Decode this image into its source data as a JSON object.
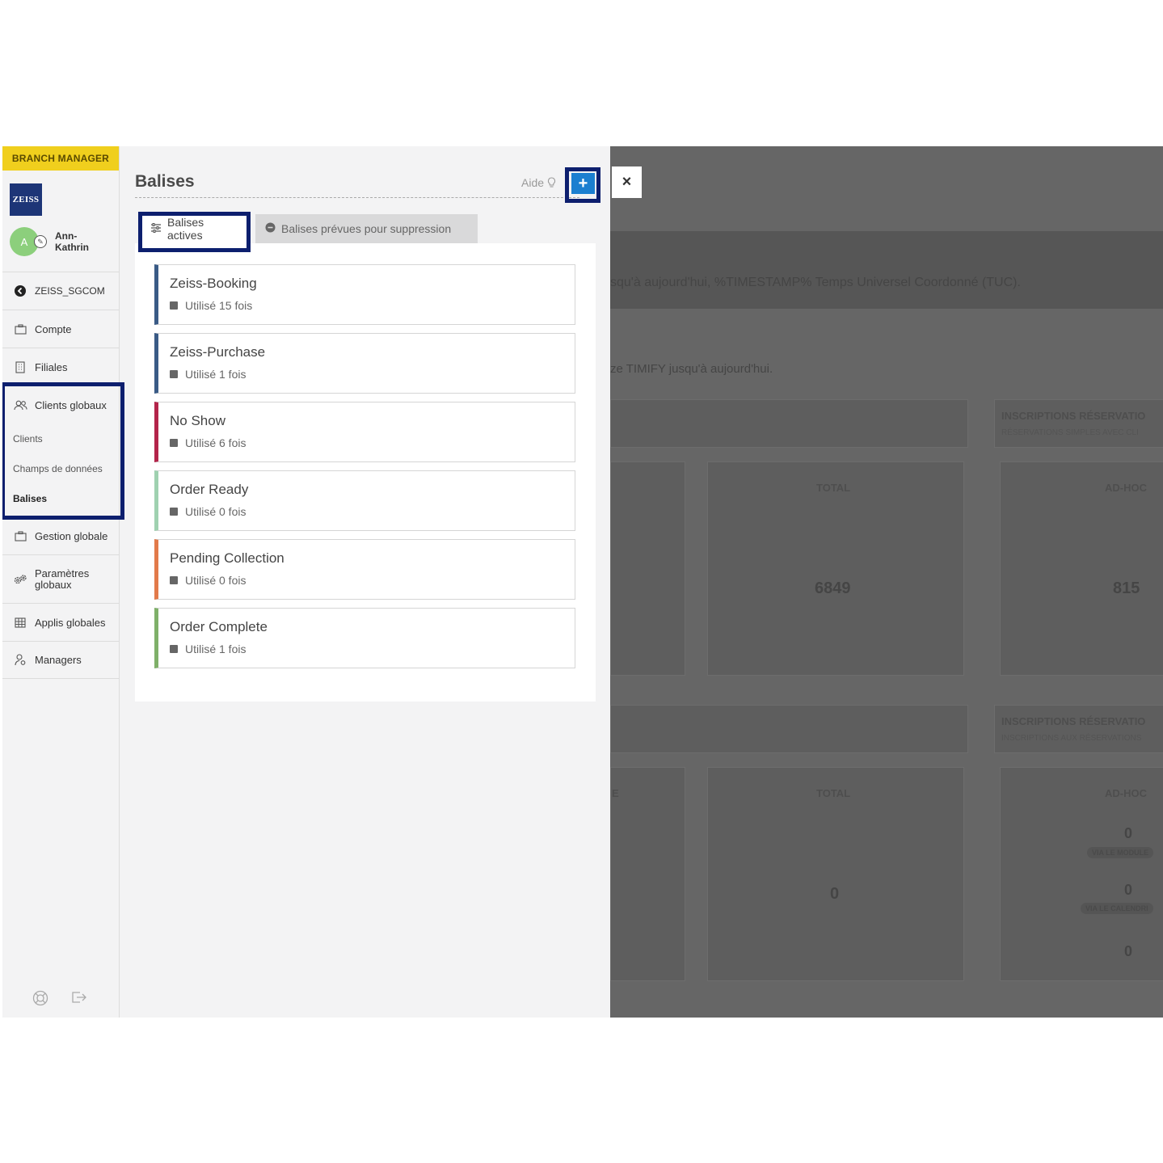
{
  "sidebar": {
    "role": "BRANCH MANAGER",
    "logo_text": "ZEISS",
    "user": {
      "initial": "A",
      "name": "Ann-Kathrin"
    },
    "back_item": "ZEISS_SGCOM",
    "items": [
      {
        "label": "Compte",
        "icon": "briefcase-icon"
      },
      {
        "label": "Filiales",
        "icon": "building-icon"
      },
      {
        "label": "Clients globaux",
        "icon": "users-icon"
      },
      {
        "label": "Gestion globale",
        "icon": "briefcase-icon"
      },
      {
        "label": "Paramètres globaux",
        "icon": "gears-icon"
      },
      {
        "label": "Applis globales",
        "icon": "grid-icon"
      },
      {
        "label": "Managers",
        "icon": "managers-icon"
      }
    ],
    "sub_items": [
      "Clients",
      "Champs de données",
      "Balises"
    ],
    "active_sub": "Balises"
  },
  "drawer": {
    "title": "Balises",
    "help_label": "Aide",
    "add_label": "+",
    "close_label": "×",
    "tabs": [
      {
        "label": "Balises actives",
        "active": true
      },
      {
        "label": "Balises prévues pour suppression",
        "active": false
      }
    ],
    "tags": [
      {
        "name": "Zeiss-Booking",
        "usage": "Utilisé 15 fois",
        "color": "#3a5b86"
      },
      {
        "name": "Zeiss-Purchase",
        "usage": "Utilisé 1 fois",
        "color": "#3a5b86"
      },
      {
        "name": "No Show",
        "usage": "Utilisé 6 fois",
        "color": "#b3244a"
      },
      {
        "name": "Order Ready",
        "usage": "Utilisé 0 fois",
        "color": "#9fd1b0"
      },
      {
        "name": "Pending Collection",
        "usage": "Utilisé 0 fois",
        "color": "#e27a4a"
      },
      {
        "name": "Order Complete",
        "usage": "Utilisé 1 fois",
        "color": "#7fb069"
      }
    ]
  },
  "background": {
    "banner_text": "squ'à aujourd'hui, %TIMESTAMP% Temps Universel Coordonné (TUC).",
    "sub_text": "ze TIMIFY jusqu'à aujourd'hui.",
    "section1": {
      "header": "INSCRIPTIONS RÉSERVATIO",
      "sub": "RÉSERVATIONS SIMPLES AVEC CLI",
      "total_label": "TOTAL",
      "total_value": "6849",
      "adhoc_label": "AD-HOC",
      "adhoc_value": "815"
    },
    "section2": {
      "header": "INSCRIPTIONS RÉSERVATIO",
      "sub": "INSCRIPTIONS AUX RÉSERVATIONS",
      "left_label": "E",
      "total_label": "TOTAL",
      "total_value": "0",
      "adhoc_label": "AD-HOC",
      "adhoc_values": [
        "0",
        "0",
        "0"
      ],
      "pill1": "VIA LE MODULE",
      "pill2": "VIA LE CALENDRI"
    }
  }
}
